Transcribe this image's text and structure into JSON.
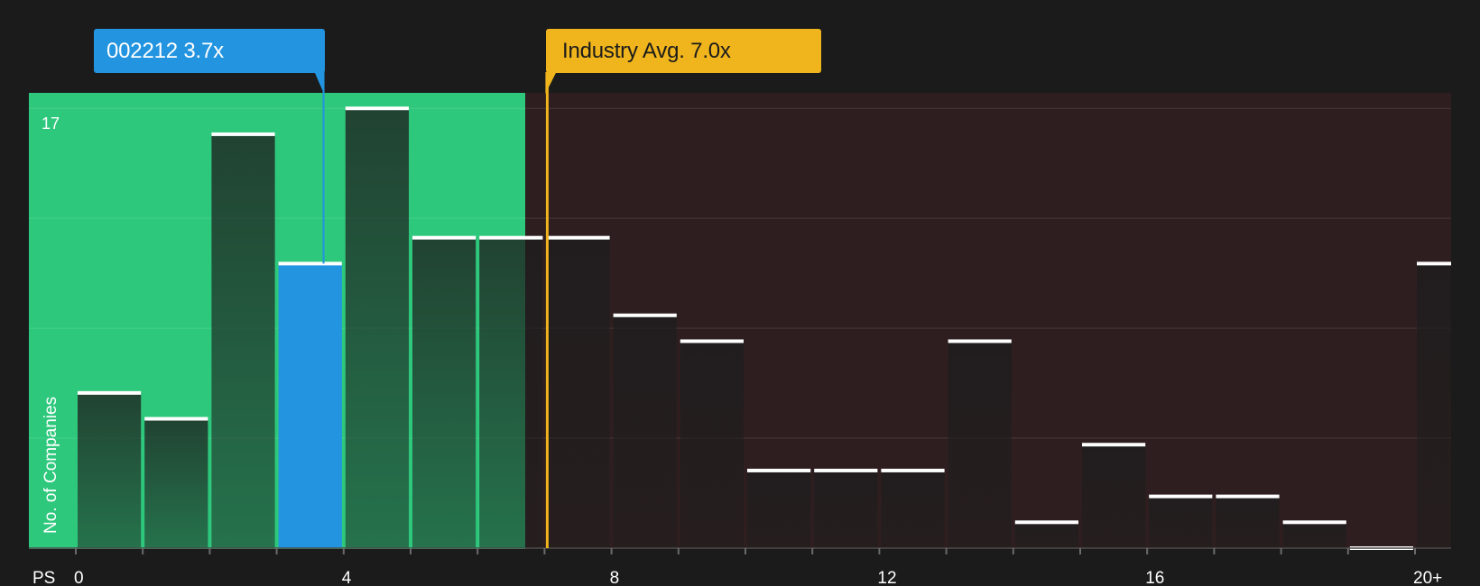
{
  "chart_data": {
    "type": "bar",
    "xlabel": "PS",
    "ylabel": "No. of Companies",
    "y_max_label": "17",
    "ylim": [
      0,
      17.6
    ],
    "x_tick_labels": [
      {
        "value": 0,
        "label": "0"
      },
      {
        "value": 4,
        "label": "4"
      },
      {
        "value": 8,
        "label": "8"
      },
      {
        "value": 12,
        "label": "12"
      },
      {
        "value": 16,
        "label": "16"
      },
      {
        "value": 20,
        "label": "20+"
      }
    ],
    "bins": [
      {
        "start": 0,
        "count": 6
      },
      {
        "start": 1,
        "count": 5
      },
      {
        "start": 2,
        "count": 16
      },
      {
        "start": 3,
        "count": 11
      },
      {
        "start": 4,
        "count": 17
      },
      {
        "start": 5,
        "count": 12
      },
      {
        "start": 6,
        "count": 12
      },
      {
        "start": 7,
        "count": 12
      },
      {
        "start": 8,
        "count": 9
      },
      {
        "start": 9,
        "count": 8
      },
      {
        "start": 10,
        "count": 3
      },
      {
        "start": 11,
        "count": 3
      },
      {
        "start": 12,
        "count": 3
      },
      {
        "start": 13,
        "count": 8
      },
      {
        "start": 14,
        "count": 1
      },
      {
        "start": 15,
        "count": 4
      },
      {
        "start": 16,
        "count": 2
      },
      {
        "start": 17,
        "count": 2
      },
      {
        "start": 18,
        "count": 1
      },
      {
        "start": 19,
        "count": 0
      },
      {
        "start": 20,
        "count": 11
      }
    ],
    "highlight_bin_start": 3,
    "company": {
      "label": "002212 3.7x",
      "value": 3.7
    },
    "industry": {
      "label": "Industry Avg. 7.0x",
      "value": 7.0
    },
    "colors": {
      "background": "#1b1b1b",
      "undervalued_zone": "#2ec87c",
      "overvalued_zone": "#2f1e1f",
      "bar": "#1d1d1d",
      "highlight_bar": "#2394e0",
      "company_accent": "#2394e0",
      "industry_accent": "#f0b41c",
      "bar_cap": "#ffffff"
    }
  }
}
